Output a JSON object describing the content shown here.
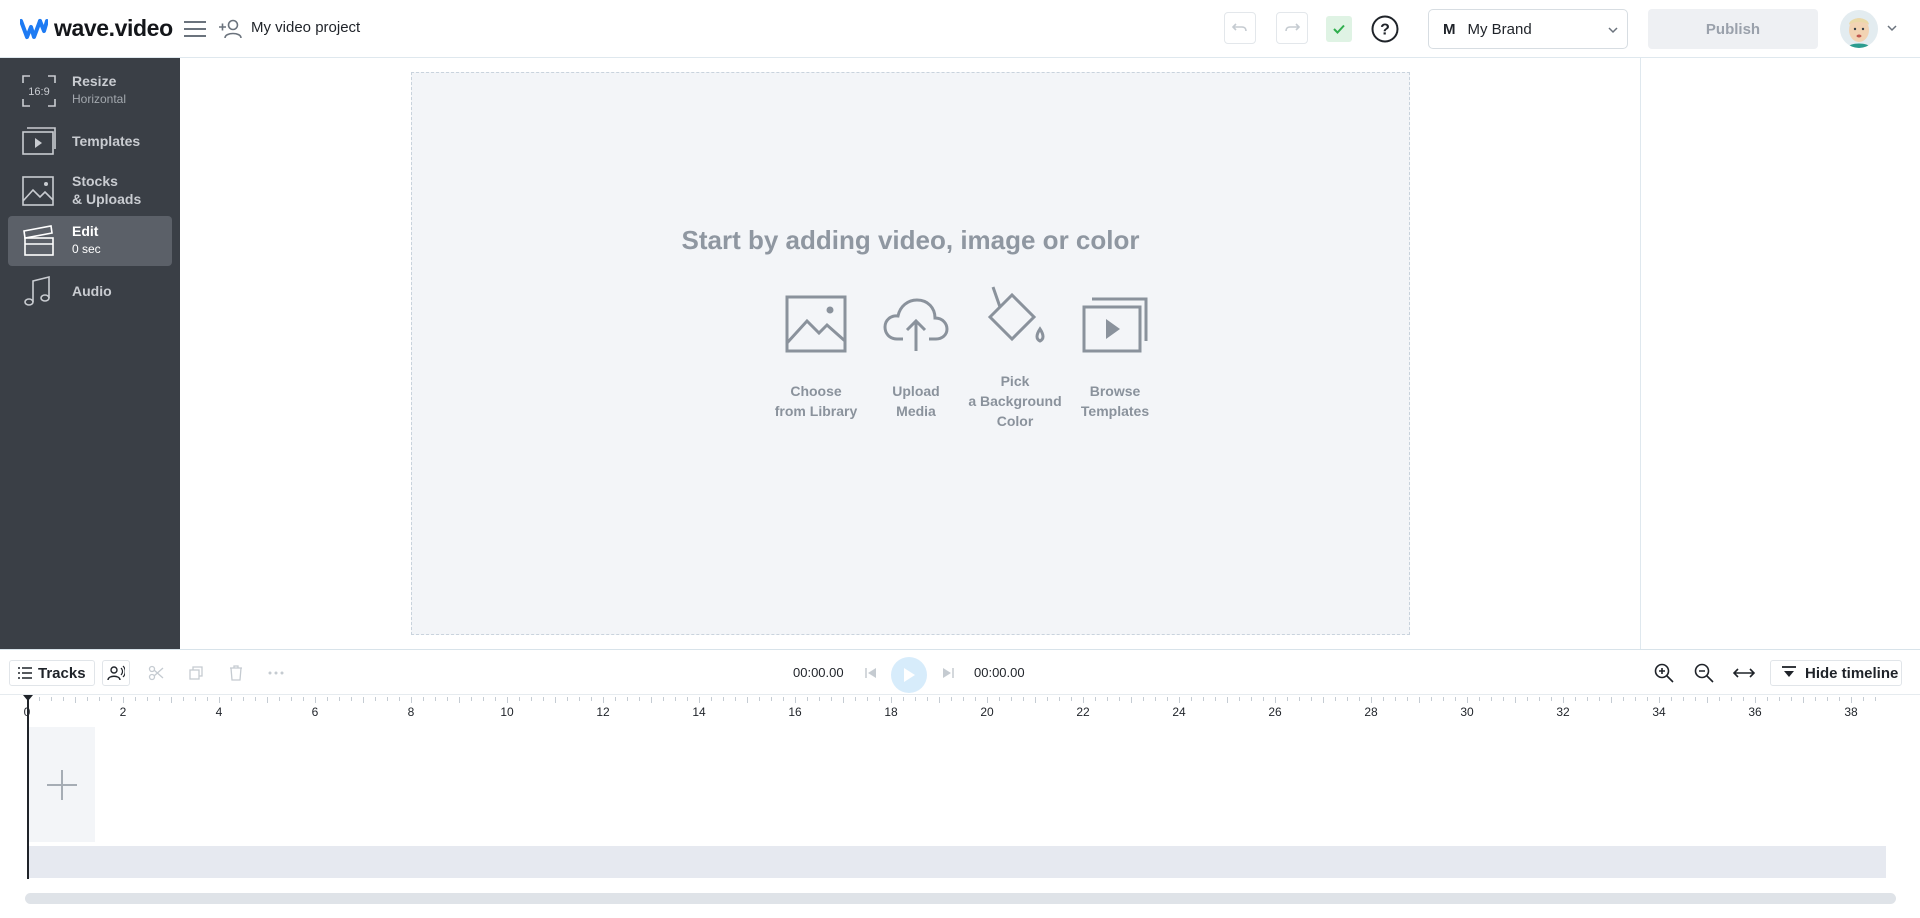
{
  "header": {
    "logo_text": "wave.video",
    "project_name": "My video project",
    "brand_initial": "M",
    "brand_name": "My Brand",
    "publish_label": "Publish"
  },
  "sidebar": {
    "items": [
      {
        "label": "Resize",
        "sub": "Horizontal",
        "icon": "aspect-ratio-icon",
        "icon_text": "16:9"
      },
      {
        "label": "Templates",
        "sub": "",
        "icon": "templates-icon"
      },
      {
        "label": "Stocks",
        "label2": "& Uploads",
        "icon": "image-icon"
      },
      {
        "label": "Edit",
        "sub": "0 sec",
        "icon": "clapperboard-icon",
        "active": true
      },
      {
        "label": "Audio",
        "sub": "",
        "icon": "music-note-icon"
      }
    ]
  },
  "canvas": {
    "title": "Start by adding video, image or color",
    "actions": [
      {
        "label": "Choose\nfrom Library",
        "icon": "image-icon"
      },
      {
        "label": "Upload\nMedia",
        "icon": "cloud-upload-icon"
      },
      {
        "label": "Pick\na Background\nColor",
        "icon": "paint-bucket-icon"
      },
      {
        "label": "Browse\nTemplates",
        "icon": "templates-play-icon"
      }
    ]
  },
  "timeline": {
    "tracks_label": "Tracks",
    "current_time": "00:00.00",
    "total_time": "00:00.00",
    "hide_label": "Hide timeline",
    "ruler_labels": [
      "0",
      "2",
      "4",
      "6",
      "8",
      "10",
      "12",
      "14",
      "16",
      "18",
      "20",
      "22",
      "24",
      "26",
      "28",
      "30",
      "32",
      "34",
      "36",
      "38"
    ]
  },
  "colors": {
    "sidebar_bg": "#3a3f46",
    "sidebar_active": "#5b6068",
    "canvas_bg": "#f3f5f8",
    "accent_blue": "#1e7bf3",
    "saved_green": "#2fae4d"
  }
}
